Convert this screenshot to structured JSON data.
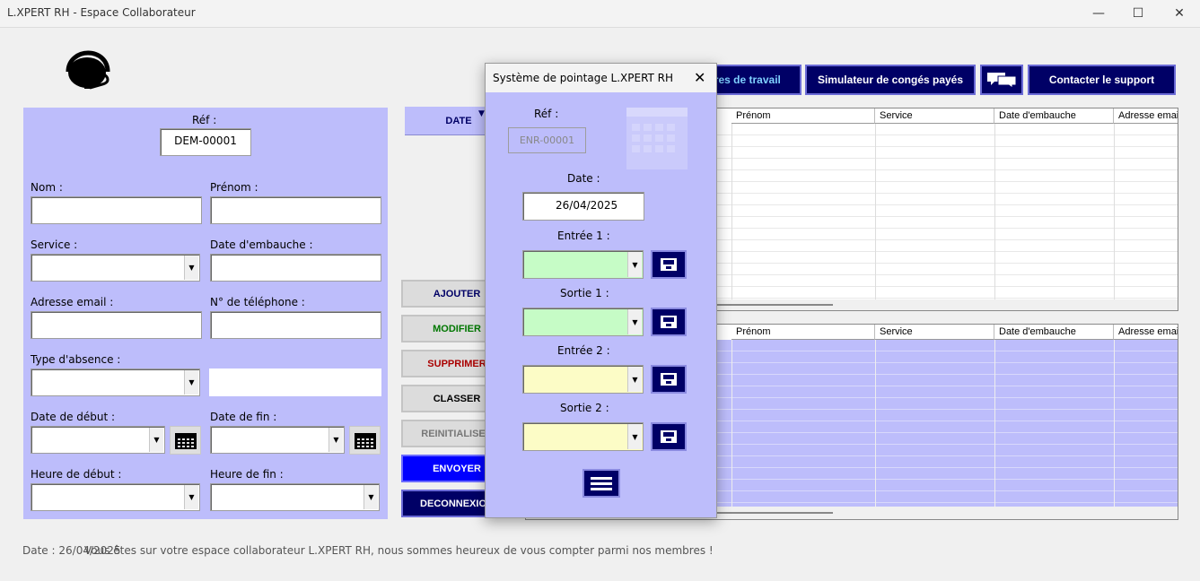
{
  "window": {
    "title": "L.XPERT RH - Espace Collaborateur",
    "controls": [
      "—",
      "☐",
      "✕"
    ]
  },
  "form": {
    "ref_label": "Réf :",
    "ref_value": "DEM-00001",
    "nom_label": "Nom :",
    "prenom_label": "Prénom :",
    "service_label": "Service :",
    "date_embauche_label": "Date d'embauche :",
    "email_label": "Adresse email :",
    "telephone_label": "N° de téléphone :",
    "type_absence_label": "Type d'absence :",
    "date_debut_label": "Date de début :",
    "date_fin_label": "Date de fin :",
    "heure_debut_label": "Heure de début :",
    "heure_fin_label": "Heure de fin :"
  },
  "sidebar": {
    "date_tab": "DATE",
    "ajouter": "AJOUTER",
    "modifier": "MODIFIER",
    "supprimer": "SUPPRIMER",
    "classer": "CLASSER",
    "reinitialiser": "REINITIALISER",
    "envoyer": "ENVOYER",
    "deconnexion": "DECONNEXION"
  },
  "toolbar": {
    "heures_travail": "Heures de travail",
    "simulateur": "Simulateur de congés payés",
    "contact": "Contacter le support"
  },
  "grid1": {
    "columns": [
      "Prénom",
      "Service",
      "Date d'embauche",
      "Adresse emai"
    ]
  },
  "grid2": {
    "columns": [
      "Prénom",
      "Service",
      "Date d'embauche",
      "Adresse emai"
    ]
  },
  "status": {
    "date_label": "Date :",
    "date_value": "26/04/2025",
    "welcome": "Vous êtes sur votre espace collaborateur L.XPERT RH, nous sommes heureux de vous compter parmi nos membres !"
  },
  "dialog": {
    "title": "Système de pointage L.XPERT RH",
    "close": "✕",
    "ref_label": "Réf :",
    "ref_value": "ENR-00001",
    "date_label": "Date :",
    "date_value": "26/04/2025",
    "entree1_label": "Entrée 1 :",
    "sortie1_label": "Sortie 1 :",
    "entree2_label": "Entrée 2 :",
    "sortie2_label": "Sortie 2 :"
  },
  "colors": {
    "panel": "#bdbdfb",
    "navy": "#000066",
    "green_field": "#c6fcc6",
    "yellow_field": "#fcfcc6",
    "envoyer": "#0000ff"
  }
}
